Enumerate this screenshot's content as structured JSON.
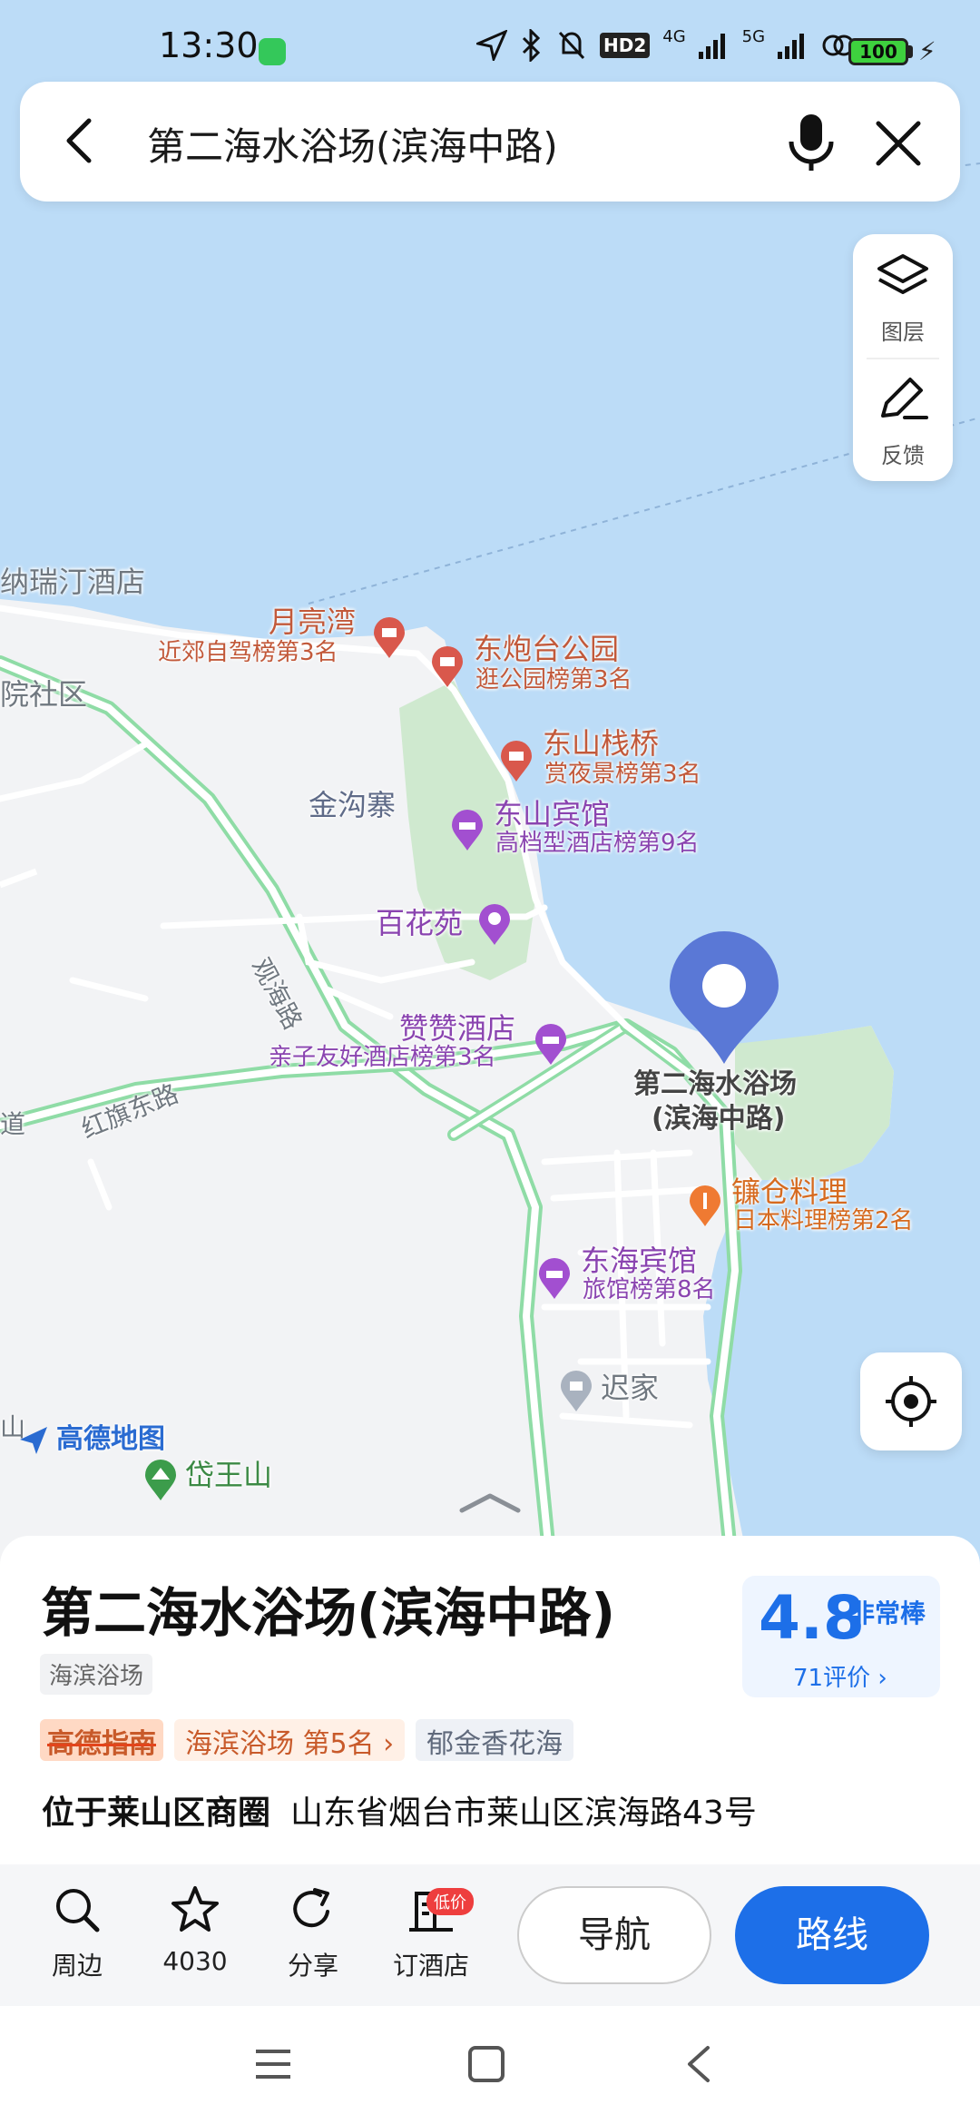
{
  "status_bar": {
    "time": "13:30",
    "network_badge": "HD2",
    "net1": "4G",
    "net2": "5G",
    "battery": "100"
  },
  "search": {
    "query": "第二海水浴场(滨海中路)"
  },
  "tools": {
    "layers_label": "图层",
    "feedback_label": "反馈"
  },
  "map": {
    "labels": {
      "hotel_top": "纳瑞汀酒店",
      "community": "院社区",
      "jingouzhai": "金沟寨",
      "guanhai_road": "观海路",
      "hongqi_road": "红旗东路",
      "dao": "道",
      "chijia": "迟家",
      "daiwangshan": "岱王山",
      "shan": "山"
    },
    "pois": {
      "moon_bay": {
        "name": "月亮湾",
        "rank": "近郊自驾榜第3名"
      },
      "dongpaotai": {
        "name": "东炮台公园",
        "rank": "逛公园榜第3名"
      },
      "dongshan_bridge": {
        "name": "东山栈桥",
        "rank": "赏夜景榜第3名"
      },
      "dongshan_hotel": {
        "name": "东山宾馆",
        "rank": "高档型酒店榜第9名"
      },
      "baihuayuan": {
        "name": "百花苑"
      },
      "zanzan_hotel": {
        "name": "赞赞酒店",
        "rank": "亲子友好酒店榜第3名"
      },
      "selected": {
        "name_line1": "第二海水浴场",
        "name_line2": "(滨海中路)"
      },
      "kamakura": {
        "name": "镰仓料理",
        "rank": "日本料理榜第2名"
      },
      "donghai_hotel": {
        "name": "东海宾馆",
        "rank": "旅馆榜第8名"
      }
    },
    "watermark": "高德地图"
  },
  "place": {
    "title": "第二海水浴场(滨海中路)",
    "category": "海滨浴场",
    "rating": "4.8",
    "rating_desc": "非常棒",
    "review_count": "71评价 ›",
    "guide_badge": "高德指南",
    "rank": "海滨浴场 第5名 ›",
    "tag": "郁金香花海",
    "area": "位于莱山区商圈",
    "address": "山东省烟台市莱山区滨海路43号"
  },
  "actions": {
    "nearby": "周边",
    "favorite_count": "4030",
    "share": "分享",
    "book_hotel": "订酒店",
    "low_price_badge": "低价",
    "navigate": "导航",
    "route": "路线"
  },
  "colors": {
    "sea": "#bcdcf7",
    "land": "#f2f3f5",
    "park": "#cfe9cf",
    "road_edge": "#8fdca6",
    "accent": "#1d6fe8",
    "pin": "#5a78d6"
  }
}
